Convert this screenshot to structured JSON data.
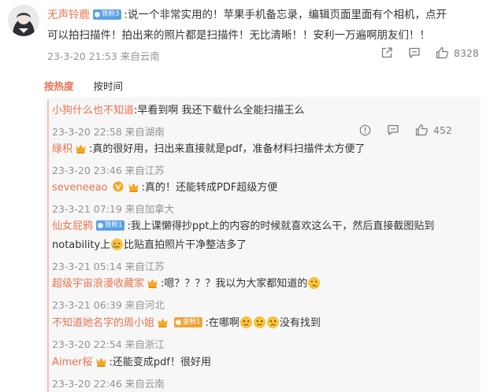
{
  "main": {
    "username": "无声铃鹿",
    "badge": "铁粉3",
    "text_line1": ":说一个非常实用的！苹果手机备忘录，编辑页面里面有个相机，点开",
    "text_line2": "可以拍扫描件！拍出来的照片都是扫描件！无比清晰！！安利一万遍啊朋友们！！",
    "timestamp": "23-3-20 21:53",
    "location": "来自云南",
    "like_count": "8328"
  },
  "sort_tabs": {
    "hot": "按热度",
    "time": "按时间"
  },
  "replies": [
    {
      "name": "小狗什么也不知道",
      "text": ":早看到啊 我还下载什么全能扫描王么",
      "timestamp": "23-3-20 22:58",
      "location": "来自湖南",
      "like_count": "452"
    },
    {
      "name": "綠枳",
      "text": ":真的很好用，扫出来直接就是pdf，准备材料扫描件太方便了",
      "timestamp": "23-3-20 23:46",
      "location": "来自江苏"
    },
    {
      "name": "seveneeao",
      "text": ":真的！还能转成PDF超级方便",
      "timestamp": "23-3-21 07:19",
      "location": "来自加拿大"
    },
    {
      "name": "仙女屁鸦",
      "badge": "铁粉1",
      "text_line1": ":我上课懒得抄ppt上的内容的时候就喜欢这么干，然后直接截图贴到",
      "text_line2_a": "notability上",
      "text_line2_b": "比贴直拍照片干净整洁多了",
      "timestamp": "23-3-21 05:14",
      "location": "来自江苏"
    },
    {
      "name": "超级宇宙浪漫收藏家",
      "text": ":嗯？？？？我以为大家都知道的",
      "timestamp": "23-3-21 06:39",
      "location": "来自河北"
    },
    {
      "name": "不知道她名字的周小姐",
      "badge": "金粉1",
      "text_a": ":在哪啊",
      "text_b": "没有找到",
      "timestamp": "23-3-20 22:54",
      "location": "来自浙江"
    },
    {
      "name": "Aimer桜",
      "text": ":还能变成pdf！很好用",
      "timestamp": "23-3-20 22:46",
      "location": "来自云南"
    }
  ],
  "colors": {
    "name": "#eb7350",
    "meta": "#939393",
    "panel": "#f7f7f7",
    "badge_blue": "#5aa0e6",
    "badge_gold": "#f0a33a",
    "crown": "#f5a623"
  }
}
